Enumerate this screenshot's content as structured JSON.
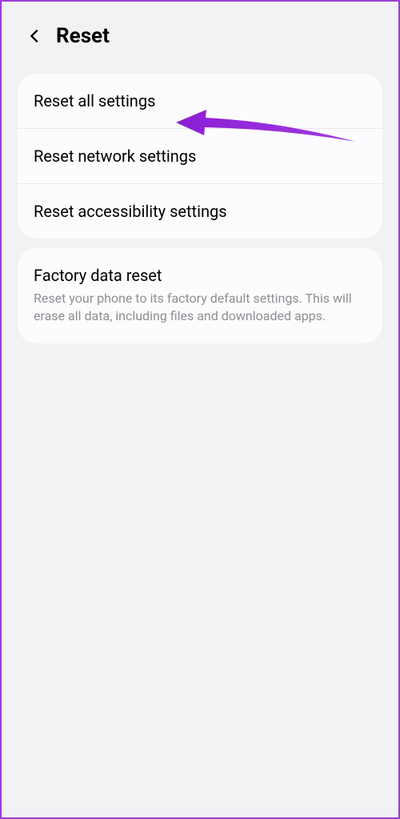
{
  "header": {
    "title": "Reset"
  },
  "group1": {
    "items": [
      {
        "label": "Reset all settings"
      },
      {
        "label": "Reset network settings"
      },
      {
        "label": "Reset accessibility settings"
      }
    ]
  },
  "group2": {
    "items": [
      {
        "label": "Factory data reset",
        "description": "Reset your phone to its factory default settings. This will erase all data, including files and downloaded apps."
      }
    ]
  }
}
